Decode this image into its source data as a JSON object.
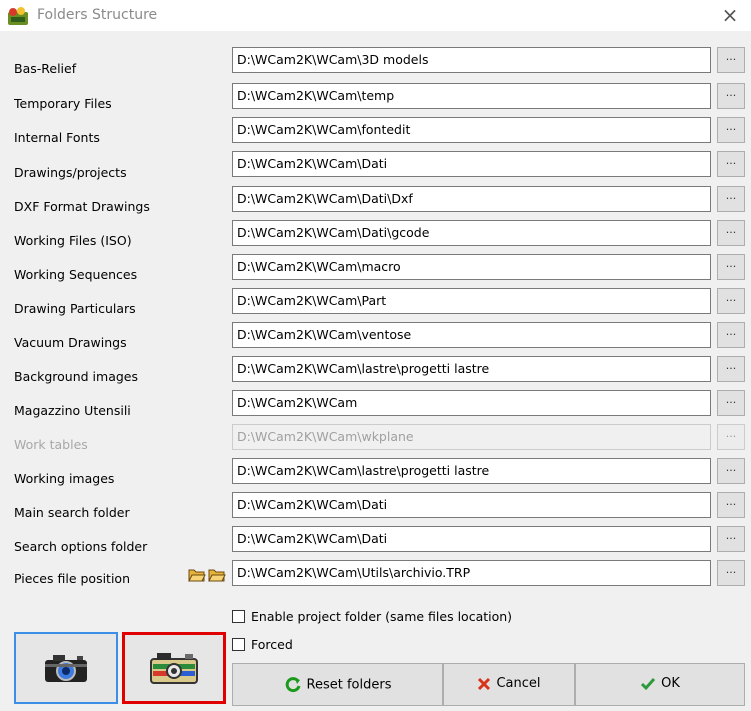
{
  "window": {
    "title": "Folders Structure",
    "close_glyph": "×",
    "icon": "wcam-app-icon"
  },
  "folders": [
    {
      "label": "Bas-Relief",
      "path": "D:\\WCam2K\\WCam\\3D models",
      "enabled": true
    },
    {
      "label": "Temporary Files",
      "path": "D:\\WCam2K\\WCam\\temp",
      "enabled": true
    },
    {
      "label": "Internal Fonts",
      "path": "D:\\WCam2K\\WCam\\fontedit",
      "enabled": true
    },
    {
      "label": "Drawings/projects",
      "path": "D:\\WCam2K\\WCam\\Dati",
      "enabled": true
    },
    {
      "label": "DXF Format Drawings",
      "path": "D:\\WCam2K\\WCam\\Dati\\Dxf",
      "enabled": true
    },
    {
      "label": "Working Files (ISO)",
      "path": "D:\\WCam2K\\WCam\\Dati\\gcode",
      "enabled": true
    },
    {
      "label": "Working Sequences",
      "path": "D:\\WCam2K\\WCam\\macro",
      "enabled": true
    },
    {
      "label": "Drawing Particulars",
      "path": "D:\\WCam2K\\WCam\\Part",
      "enabled": true
    },
    {
      "label": "Vacuum Drawings",
      "path": "D:\\WCam2K\\WCam\\ventose",
      "enabled": true
    },
    {
      "label": "Background images",
      "path": "D:\\WCam2K\\WCam\\lastre\\progetti lastre",
      "enabled": true
    },
    {
      "label": "Magazzino Utensili",
      "path": "D:\\WCam2K\\WCam",
      "enabled": true
    },
    {
      "label": "Work tables",
      "path": "D:\\WCam2K\\WCam\\wkplane",
      "enabled": false
    },
    {
      "label": "Working images",
      "path": "D:\\WCam2K\\WCam\\lastre\\progetti lastre",
      "enabled": true
    },
    {
      "label": "Main search folder",
      "path": "D:\\WCam2K\\WCam\\Dati",
      "enabled": true
    },
    {
      "label": "Search options folder",
      "path": "D:\\WCam2K\\WCam\\Dati",
      "enabled": true
    },
    {
      "label": "Pieces file position",
      "path": "D:\\WCam2K\\WCam\\Utils\\archivio.TRP",
      "enabled": true
    }
  ],
  "browse_label": "...",
  "pieces_icons": [
    "folder-open-icon",
    "folder-open-icon"
  ],
  "options": {
    "enable_project_folder": {
      "label": "Enable project folder (same files location)",
      "checked": false
    },
    "forced": {
      "label": "Forced",
      "checked": false
    }
  },
  "buttons": {
    "camera_1": {
      "icon": "camera-icon"
    },
    "camera_2": {
      "icon": "camera-multicolor-icon"
    },
    "reset": {
      "label": "Reset folders",
      "icon": "refresh-icon",
      "color": "#1a9a1a"
    },
    "cancel": {
      "label": "Cancel",
      "icon": "x-icon",
      "color": "#d8341c"
    },
    "ok": {
      "label": "OK",
      "icon": "check-icon",
      "color": "#2c9a3c"
    }
  },
  "colors": {
    "focus_border": "#3c8ee6",
    "highlight_border": "#e00000",
    "disabled_text": "#a8a8a8"
  }
}
